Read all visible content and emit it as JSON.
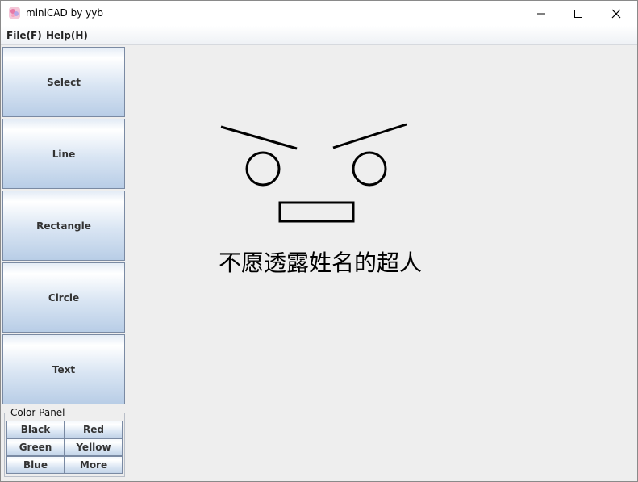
{
  "window": {
    "title": "miniCAD by yyb",
    "controls": [
      "minimize-icon",
      "maximize-icon",
      "close-icon"
    ]
  },
  "menubar": {
    "file": "File(F)",
    "help": "Help(H)"
  },
  "toolbar": {
    "tools": [
      {
        "label": "Select"
      },
      {
        "label": "Line"
      },
      {
        "label": "Rectangle"
      },
      {
        "label": "Circle"
      },
      {
        "label": "Text"
      }
    ]
  },
  "color_panel": {
    "title": "Color Panel",
    "buttons": [
      "Black",
      "Red",
      "Green",
      "Yellow",
      "Blue",
      "More"
    ]
  },
  "canvas": {
    "text": "不愿透露姓名的超人",
    "stroke_color": "#000000",
    "shapes": [
      "line",
      "line",
      "circle",
      "circle",
      "rectangle",
      "text"
    ]
  }
}
